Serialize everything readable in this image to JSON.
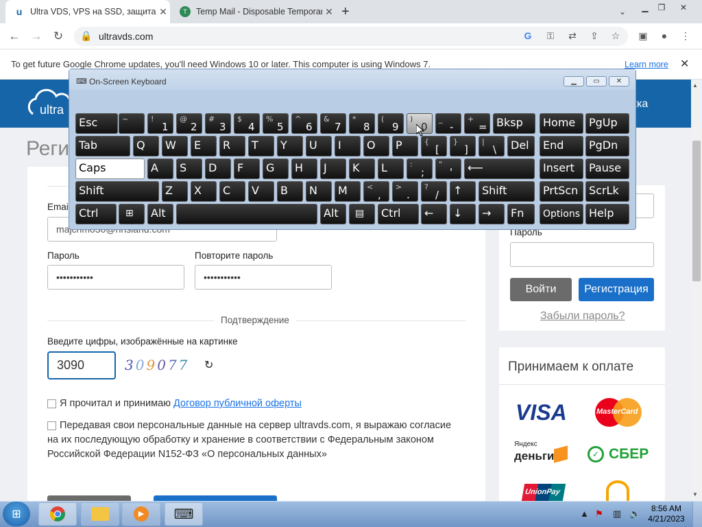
{
  "browser": {
    "tabs": [
      {
        "label": "Ultra VDS, VPS на SSD, защита о",
        "favicon": "u",
        "active": true
      },
      {
        "label": "Temp Mail - Disposable Temporar",
        "favicon": "T",
        "active": false
      }
    ],
    "new_tab": "+",
    "address": "ultravds.com",
    "infobar_text": "To get future Google Chrome updates, you'll need Windows 10 or later. This computer is using Windows 7.",
    "infobar_link": "Learn more"
  },
  "page": {
    "title_partial": "Реги",
    "header_link_partial": "кка",
    "form": {
      "email_label": "Email",
      "email_value": "majchm030@hhsland.com",
      "password_label": "Пароль",
      "password_value": "•••••••••••",
      "repeat_label": "Повторите пароль",
      "repeat_value": "•••••••••••",
      "confirm_heading": "Подтверждение",
      "captcha_label": "Введите цифры, изображённые на картинке",
      "captcha_value": "3090",
      "captcha_image_text": "309077",
      "refresh_icon": "↻",
      "agree_text": "Я прочитал и принимаю ",
      "agree_link": "Договор публичной оферты",
      "consent_text": "Передавая свои персональные данные на сервер ultravds.com, я выражаю согласие на их последующую обработку и хранение в соответствии с Федеральным законом Российской Федерации N152-ФЗ «О персональных данных»"
    },
    "login": {
      "password_label": "Пароль",
      "login_button": "Войти",
      "register_button": "Регистрация",
      "forgot_link": "Забыли пароль?"
    },
    "payment": {
      "title": "Принимаем к оплате",
      "logos": [
        "VISA",
        "MasterCard",
        "Яндекс",
        "деньги",
        "СБЕР",
        "UnionPay"
      ]
    }
  },
  "osk": {
    "title": "On-Screen Keyboard",
    "keys": {
      "esc": "Esc",
      "bksp": "Bksp",
      "home": "Home",
      "pgup": "PgUp",
      "tab": "Tab",
      "del": "Del",
      "end": "End",
      "pgdn": "PgDn",
      "caps": "Caps",
      "insert": "Insert",
      "pause": "Pause",
      "shift": "Shift",
      "prtscn": "PrtScn",
      "scrlk": "ScrLk",
      "ctrl": "Ctrl",
      "alt": "Alt",
      "fn": "Fn",
      "options": "Options",
      "help": "Help",
      "q": "Q",
      "w": "W",
      "e": "E",
      "r": "R",
      "t": "T",
      "y": "Y",
      "u": "U",
      "i": "I",
      "o": "O",
      "p": "P",
      "a": "A",
      "s": "S",
      "d": "D",
      "f": "F",
      "g": "G",
      "h": "H",
      "j": "J",
      "k": "K",
      "l": "L",
      "z": "Z",
      "x": "X",
      "c": "C",
      "v": "V",
      "b": "B",
      "n": "N",
      "m": "M",
      "grave_top": "~",
      "grave_bot": "`",
      "n1_top": "!",
      "n1": "1",
      "n2_top": "@",
      "n2": "2",
      "n3_top": "#",
      "n3": "3",
      "n4_top": "$",
      "n4": "4",
      "n5_top": "%",
      "n5": "5",
      "n6_top": "^",
      "n6": "6",
      "n7_top": "&",
      "n7": "7",
      "n8_top": "*",
      "n8": "8",
      "n9_top": "(",
      "n9": "9",
      "n0_top": ")",
      "n0": "0",
      "minus_top": "_",
      "minus": "-",
      "eq_top": "+",
      "eq": "=",
      "lbr_top": "{",
      "lbr": "[",
      "rbr_top": "}",
      "rbr": "]",
      "bsl_top": "|",
      "bsl": "\\",
      "semi_top": ":",
      "semi": ";",
      "quote_top": "\"",
      "quote": "'",
      "comma_top": "<",
      "comma": ",",
      "dot_top": ">",
      "dot": ".",
      "slash_top": "?",
      "slash": "/",
      "enter_arrow": "⟵",
      "up": "↑",
      "down": "↓",
      "left": "←",
      "right": "→"
    }
  },
  "taskbar": {
    "time": "8:56 AM",
    "date": "4/21/2023"
  },
  "colors": {
    "brand_blue": "#1565a8",
    "register_button": "#1a6fc9",
    "login_button": "#6b6b6b",
    "link": "#1a73e8"
  }
}
